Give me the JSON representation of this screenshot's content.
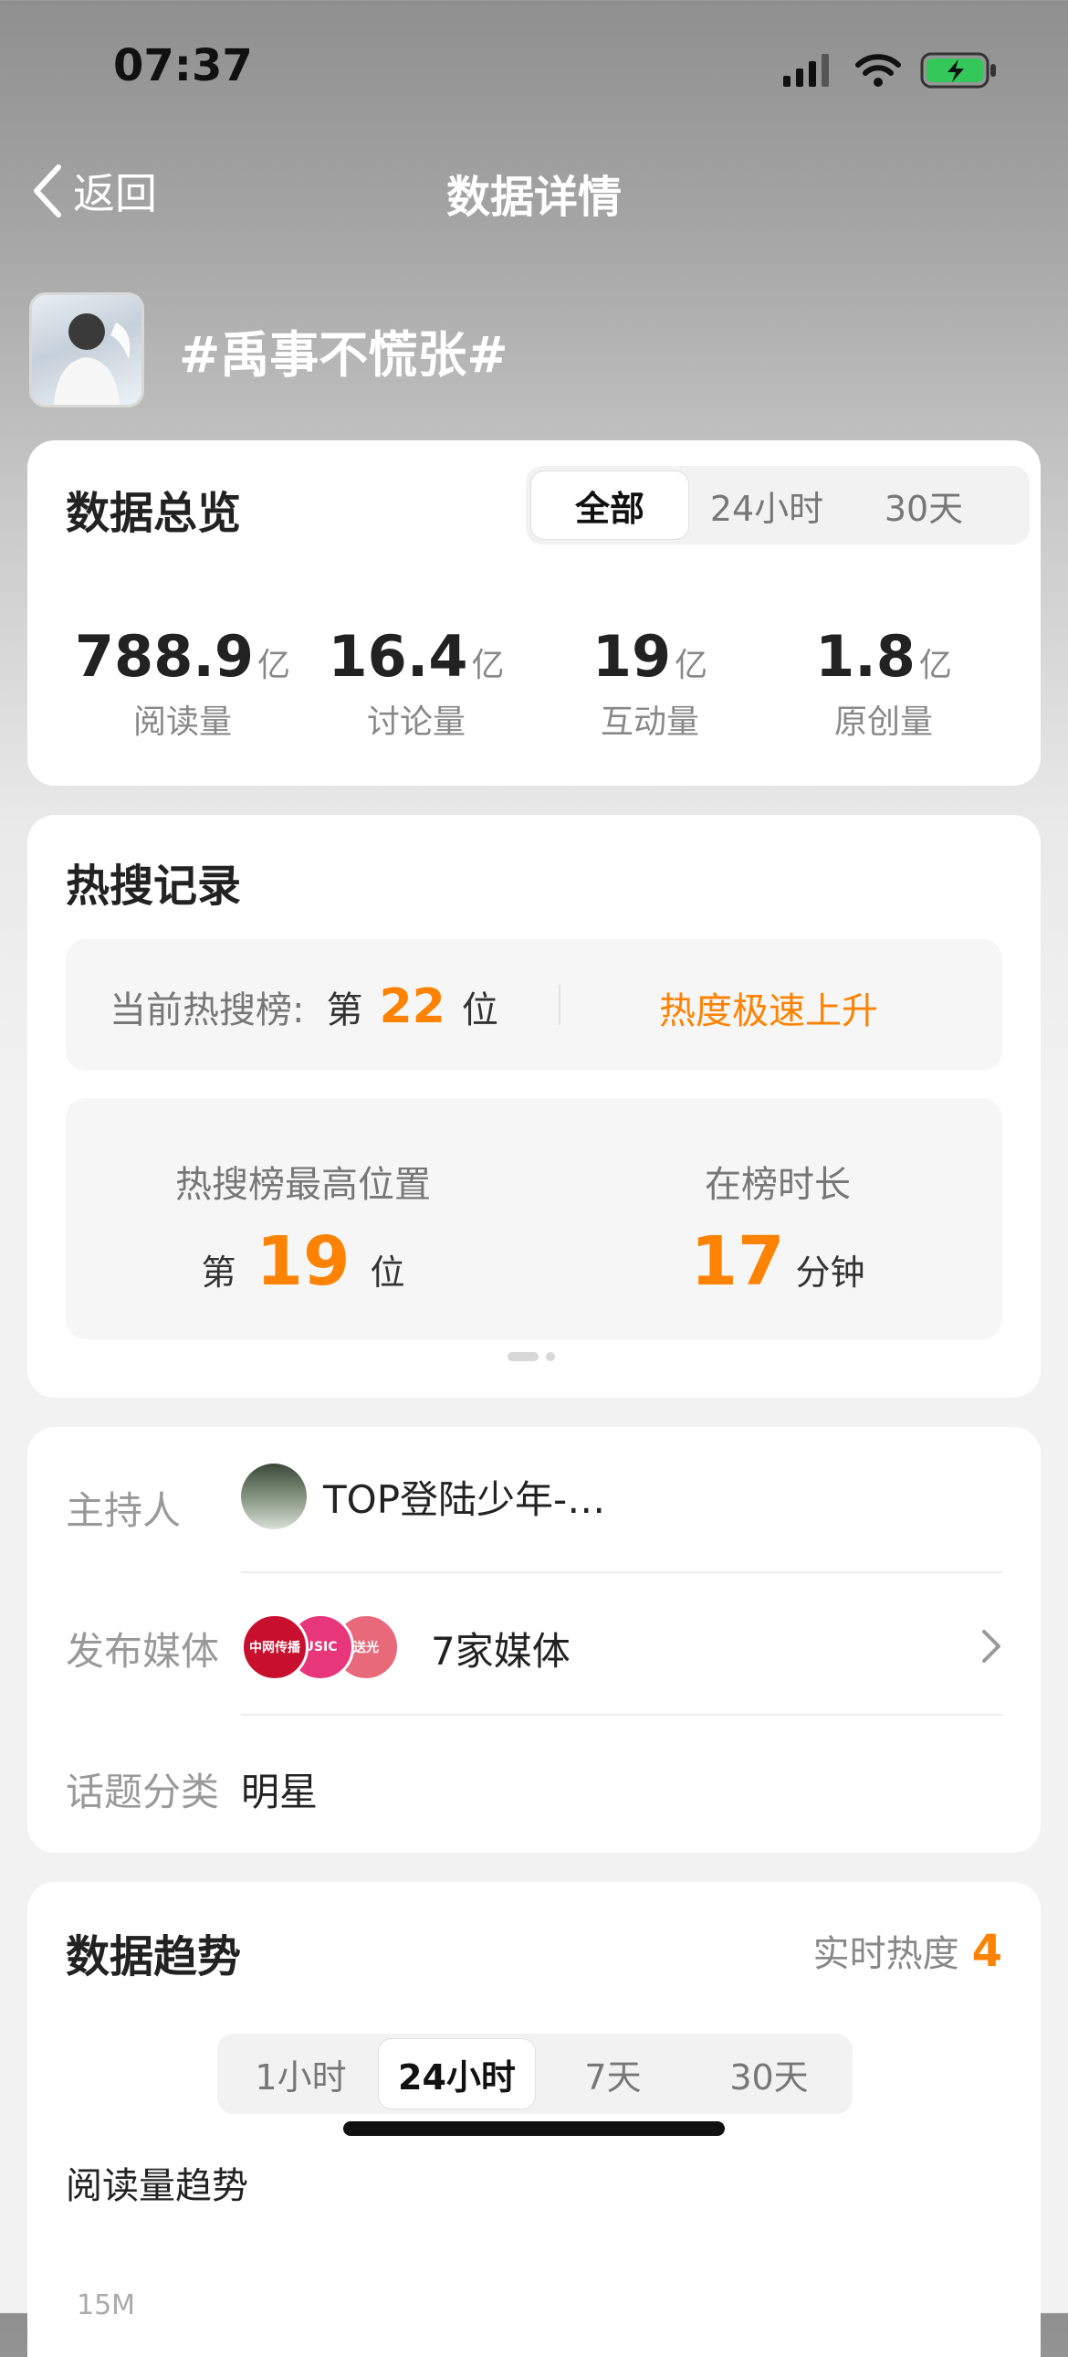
{
  "status_bar": {
    "time": "07:37"
  },
  "nav": {
    "back_label": "返回",
    "title": "数据详情"
  },
  "topic": {
    "title": "#禹事不慌张#"
  },
  "overview": {
    "title": "数据总览",
    "tabs": [
      "全部",
      "24小时",
      "30天"
    ],
    "active_tab": "全部",
    "stats": [
      {
        "value": "788.9",
        "unit": "亿",
        "label": "阅读量"
      },
      {
        "value": "16.4",
        "unit": "亿",
        "label": "讨论量"
      },
      {
        "value": "19",
        "unit": "亿",
        "label": "互动量"
      },
      {
        "value": "1.8",
        "unit": "亿",
        "label": "原创量"
      }
    ]
  },
  "hot_search": {
    "title": "热搜记录",
    "current_label": "当前热搜榜:",
    "current_prefix": "第",
    "current_rank": "22",
    "current_suffix": "位",
    "trend_text": "热度极速上升",
    "best_label": "热搜榜最高位置",
    "best_prefix": "第",
    "best_rank": "19",
    "best_suffix": "位",
    "duration_label": "在榜时长",
    "duration_value": "17",
    "duration_unit": "分钟"
  },
  "info": {
    "host_label": "主持人",
    "host_name": "TOP登陆少年-…",
    "media_label": "发布媒体",
    "media_logos": [
      "中网传播",
      "USIC",
      "送光"
    ],
    "media_count": "7家媒体",
    "category_label": "话题分类",
    "category_value": "明星"
  },
  "trend": {
    "title": "数据趋势",
    "realtime_label": "实时热度",
    "realtime_value": "4",
    "tabs": [
      "1小时",
      "24小时",
      "7天",
      "30天"
    ],
    "active_tab": "24小时",
    "subtitle": "阅读量趋势",
    "y_tick": "15M"
  },
  "colors": {
    "accent": "#ff8200",
    "media_red": "#c8102e",
    "media_pink": "#e8367a"
  }
}
